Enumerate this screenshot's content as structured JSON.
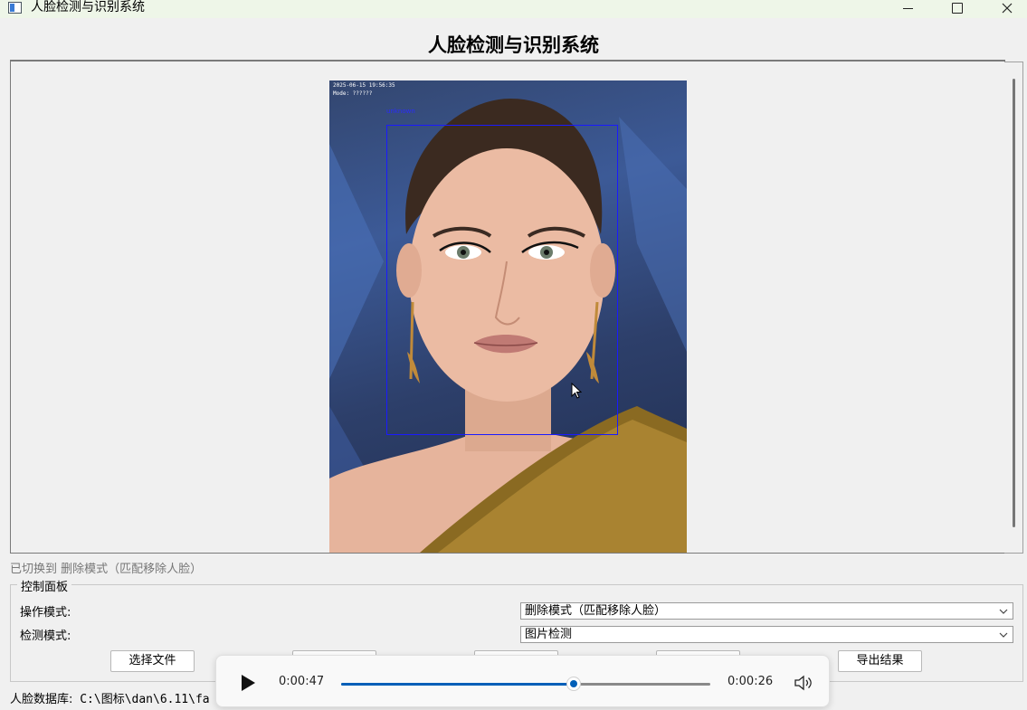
{
  "window": {
    "title": "人脸检测与识别系统",
    "controls": {
      "minimize": "minimize",
      "maximize": "maximize",
      "close": "close"
    }
  },
  "heading": "人脸检测与识别系统",
  "image_overlay": {
    "timestamp": "2025-06-15 19:56:35",
    "mode": "Mode: ??????",
    "face_label": "unknown"
  },
  "status_message": "已切换到 删除模式（匹配移除人脸）",
  "control_panel": {
    "title": "控制面板",
    "operation_mode": {
      "label": "操作模式:",
      "value": "删除模式（匹配移除人脸）"
    },
    "detection_mode": {
      "label": "检测模式:",
      "value": "图片检测"
    },
    "buttons": {
      "select_file": "选择文件",
      "export_results": "导出结果"
    }
  },
  "media_player": {
    "elapsed": "0:00:47",
    "remaining": "0:00:26",
    "progress_fraction": 0.63
  },
  "database": {
    "label": "人脸数据库:",
    "path": " C:\\图标\\dan\\6.11\\fa"
  },
  "colors": {
    "accent": "#005fb8",
    "face_box": "#1a1aff"
  }
}
